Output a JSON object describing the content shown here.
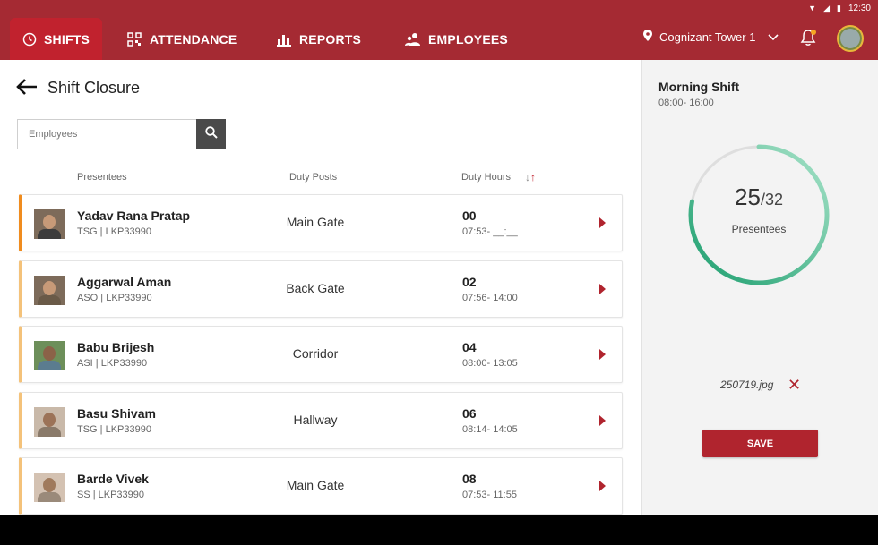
{
  "status_bar": {
    "time": "12:30"
  },
  "nav": {
    "tabs": [
      {
        "label": "SHIFTS",
        "icon": "clock-icon",
        "active": true
      },
      {
        "label": "ATTENDANCE",
        "icon": "qr-code-icon",
        "active": false
      },
      {
        "label": "REPORTS",
        "icon": "bar-chart-icon",
        "active": false
      },
      {
        "label": "EMPLOYEES",
        "icon": "people-icon",
        "active": false
      }
    ],
    "location": "Cognizant Tower 1"
  },
  "page": {
    "title": "Shift Closure",
    "search_placeholder": "Employees",
    "columns": {
      "presentees": "Presentees",
      "duty_posts": "Duty Posts",
      "duty_hours": "Duty Hours"
    }
  },
  "employees": [
    {
      "name": "Yadav Rana Pratap",
      "meta": "TSG | LKP33990",
      "post": "Main Gate",
      "hours": "00",
      "time": "07:53- __:__"
    },
    {
      "name": "Aggarwal Aman",
      "meta": "ASO | LKP33990",
      "post": "Back Gate",
      "hours": "02",
      "time": "07:56- 14:00"
    },
    {
      "name": "Babu Brijesh",
      "meta": "ASI | LKP33990",
      "post": "Corridor",
      "hours": "04",
      "time": "08:00- 13:05"
    },
    {
      "name": "Basu Shivam",
      "meta": "TSG | LKP33990",
      "post": "Hallway",
      "hours": "06",
      "time": "08:14- 14:05"
    },
    {
      "name": "Barde Vivek",
      "meta": "SS | LKP33990",
      "post": "Main Gate",
      "hours": "08",
      "time": "07:53- 11:55"
    }
  ],
  "shift": {
    "name": "Morning Shift",
    "time": "08:00- 16:00",
    "present": "25",
    "total": "/32",
    "present_value": 25,
    "total_value": 32,
    "label": "Presentees"
  },
  "attachment": {
    "file": "250719.jpg"
  },
  "actions": {
    "save": "SAVE"
  },
  "colors": {
    "primary": "#a52a33",
    "active_tab": "#c1222e",
    "accent": "#b0242e",
    "gauge_start": "#a8e3c9",
    "gauge_end": "#1c9e6e",
    "row_flag": "#f4c27a"
  }
}
